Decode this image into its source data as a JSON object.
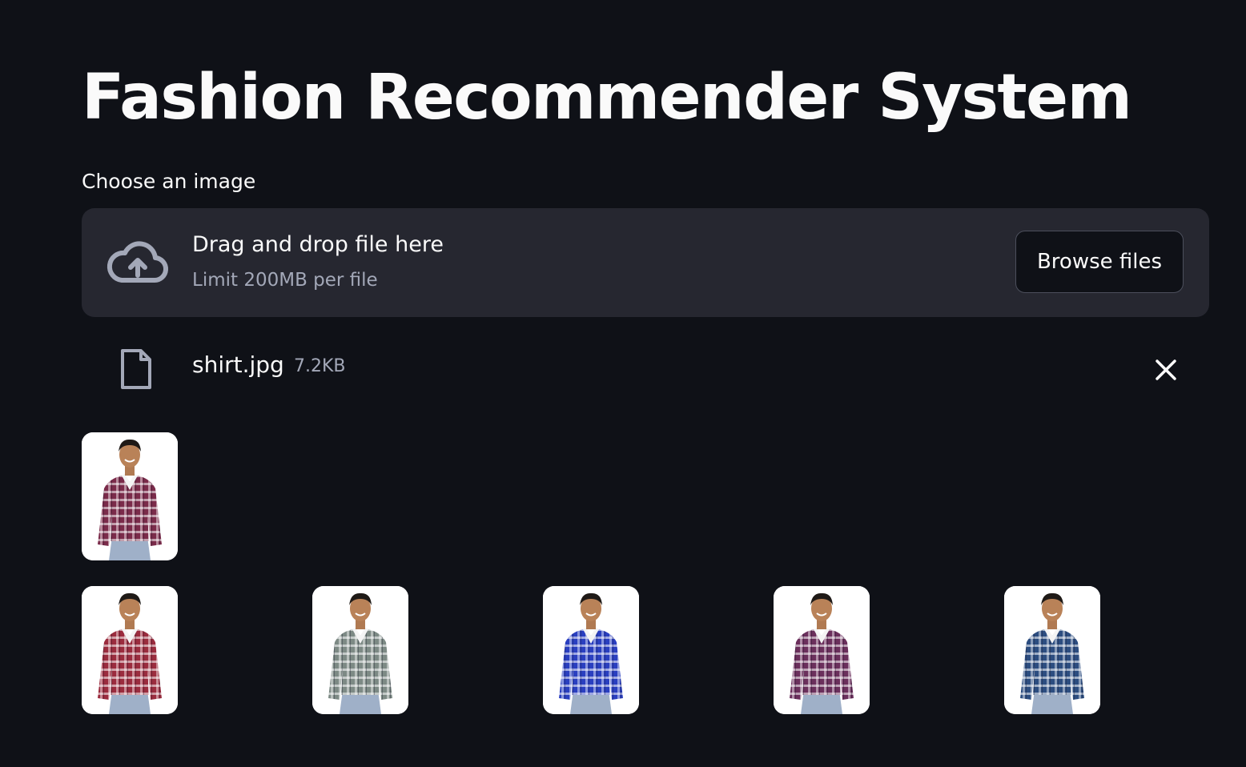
{
  "app": {
    "title": "Fashion Recommender System"
  },
  "uploader": {
    "label": "Choose an image",
    "drop_title": "Drag and drop file here",
    "limit_text": "Limit 200MB per file",
    "browse_label": "Browse files",
    "icon": "cloud-upload-icon"
  },
  "uploaded_file": {
    "name": "shirt.jpg",
    "size": "7.2KB",
    "icon": "file-icon",
    "remove_icon": "close-icon"
  },
  "uploaded_preview": {
    "description_icon": "image-thumbnail",
    "shirt_color": "#7b2b4a"
  },
  "recommendations": [
    {
      "shirt_color": "#9b2c3e"
    },
    {
      "shirt_color": "#7d8a85"
    },
    {
      "shirt_color": "#2a3fc0"
    },
    {
      "shirt_color": "#6b2f5c"
    },
    {
      "shirt_color": "#2c4d80"
    }
  ]
}
